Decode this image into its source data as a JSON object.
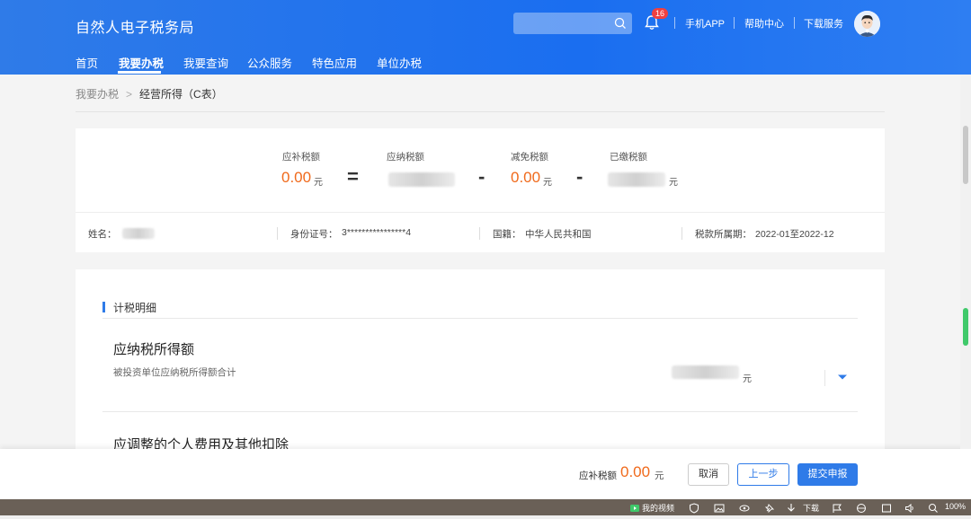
{
  "header": {
    "logo": "自然人电子税务局",
    "search_placeholder": "",
    "notification_count": "16",
    "links": [
      "手机APP",
      "帮助中心",
      "下载服务"
    ]
  },
  "nav": {
    "items": [
      "首页",
      "我要办税",
      "我要查询",
      "公众服务",
      "特色应用",
      "单位办税"
    ],
    "active": "我要办税"
  },
  "breadcrumb": {
    "parent": "我要办税",
    "separator": ">",
    "current": "经营所得（C表）"
  },
  "summary": {
    "due_label": "应补税额",
    "due_value": "0.00",
    "payable_label": "应纳税额",
    "exempt_label": "减免税额",
    "exempt_value": "0.00",
    "paid_label": "已缴税额",
    "unit": "元",
    "eq": "=",
    "minus": "-"
  },
  "info": {
    "name_label": "姓名：",
    "id_label": "身份证号：",
    "id_value": "3****************4",
    "nation_label": "国籍：",
    "nation_value": "中华人民共和国",
    "period_label": "税款所属期：",
    "period_value": "2022-01至2022-12"
  },
  "detail": {
    "section_title": "计税明细",
    "item1_title": "应纳税所得额",
    "item1_sub": "被投资单位应纳税所得额合计",
    "unit": "元",
    "item2_title": "应调整的个人费用及其他扣除"
  },
  "footer": {
    "due_label": "应补税额",
    "due_value": "0.00",
    "unit": "元",
    "cancel": "取消",
    "prev": "上一步",
    "submit": "提交申报"
  },
  "taskbar": {
    "video": "我的视频",
    "download": "下载",
    "zoom": "100%"
  },
  "colors": {
    "header_blue": "#2f7be8",
    "accent_orange": "#f06a1c"
  }
}
